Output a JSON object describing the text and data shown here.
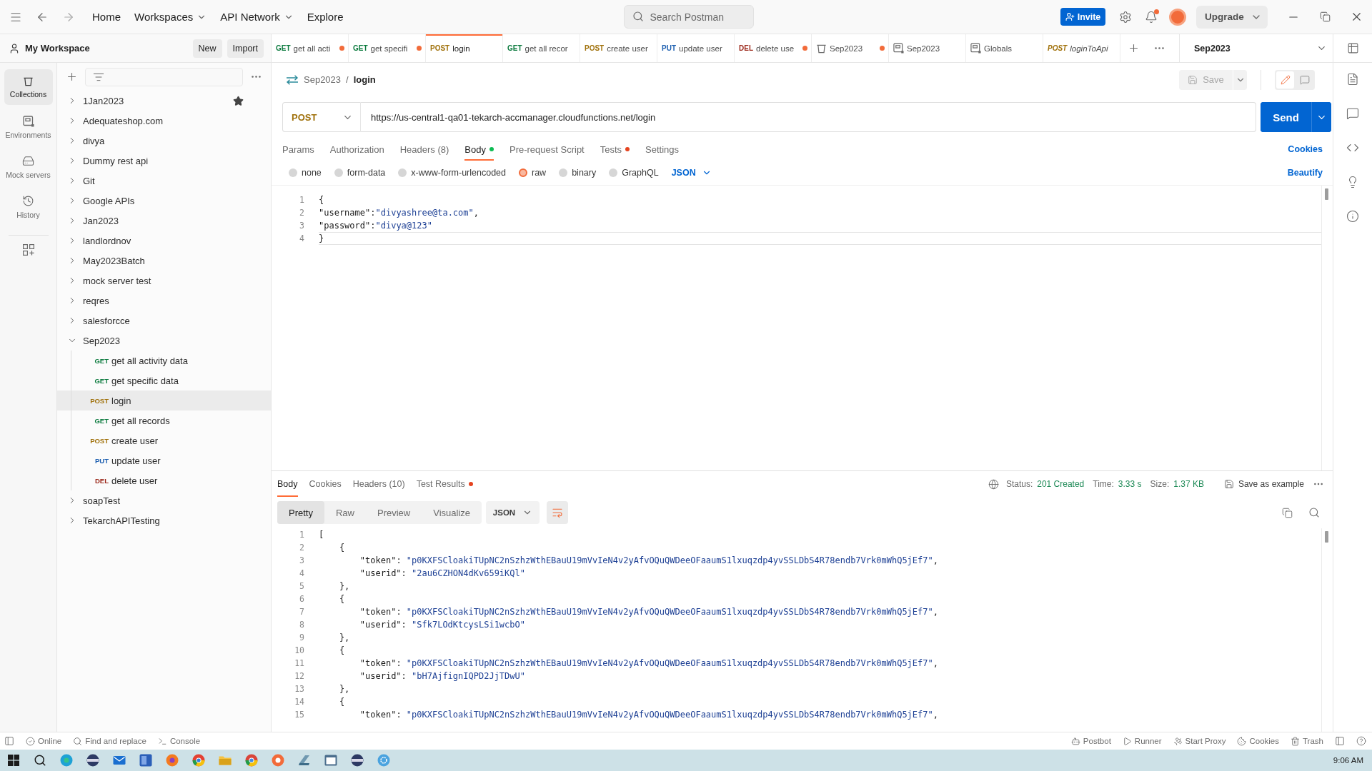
{
  "title_bar": {
    "nav": [
      {
        "label": "Home",
        "dropdown": false
      },
      {
        "label": "Workspaces",
        "dropdown": true
      },
      {
        "label": "API Network",
        "dropdown": true
      },
      {
        "label": "Explore",
        "dropdown": false
      }
    ],
    "search": {
      "placeholder": "Search Postman"
    },
    "invite": "Invite",
    "notifications_unread": true,
    "upgrade": "Upgrade"
  },
  "workspace": {
    "name": "My Workspace",
    "buttons": [
      "New",
      "Import"
    ]
  },
  "tabs": [
    {
      "kind": "request",
      "method": "GET",
      "color": "#0b7a3e",
      "title": "get all acti",
      "unsaved": true,
      "selected": false,
      "preview": false
    },
    {
      "kind": "request",
      "method": "GET",
      "color": "#0b7a3e",
      "title": "get specifi",
      "unsaved": true,
      "selected": false,
      "preview": false
    },
    {
      "kind": "request",
      "method": "POST",
      "color": "#a0710b",
      "title": "login",
      "unsaved": false,
      "selected": true,
      "preview": false
    },
    {
      "kind": "request",
      "method": "GET",
      "color": "#0b7a3e",
      "title": "get all recor",
      "unsaved": false,
      "selected": false,
      "preview": false
    },
    {
      "kind": "request",
      "method": "POST",
      "color": "#a0710b",
      "title": "create user",
      "unsaved": false,
      "selected": false,
      "preview": false
    },
    {
      "kind": "request",
      "method": "PUT",
      "color": "#1d5fb0",
      "title": "update user",
      "unsaved": false,
      "selected": false,
      "preview": false
    },
    {
      "kind": "request",
      "method": "DEL",
      "color": "#9c2a1c",
      "title": "delete use",
      "unsaved": true,
      "selected": false,
      "preview": false
    },
    {
      "kind": "collection",
      "title": "Sep2023",
      "unsaved": true,
      "selected": false,
      "preview": false
    },
    {
      "kind": "environment",
      "title": "Sep2023",
      "unsaved": false,
      "selected": false,
      "preview": false
    },
    {
      "kind": "environment",
      "title": "Globals",
      "unsaved": false,
      "selected": false,
      "preview": false
    },
    {
      "kind": "request",
      "method": "POST",
      "color": "#a0710b",
      "title": "loginToApi",
      "unsaved": false,
      "selected": false,
      "preview": true
    }
  ],
  "environment_selector": {
    "value": "Sep2023"
  },
  "rail": [
    {
      "kind": "collections",
      "label": "Collections",
      "selected": true
    },
    {
      "kind": "environments",
      "label": "Environments",
      "selected": false
    },
    {
      "kind": "mock",
      "label": "Mock servers",
      "selected": false
    },
    {
      "kind": "history",
      "label": "History",
      "selected": false
    }
  ],
  "sidebar": {
    "collections": [
      {
        "name": "1Jan2023",
        "expanded": false,
        "starred": true
      },
      {
        "name": "Adequateshop.com",
        "expanded": false,
        "starred": false
      },
      {
        "name": "divya",
        "expanded": false,
        "starred": false
      },
      {
        "name": "Dummy rest api",
        "expanded": false,
        "starred": false
      },
      {
        "name": "Git",
        "expanded": false,
        "starred": false
      },
      {
        "name": "Google APIs",
        "expanded": false,
        "starred": false
      },
      {
        "name": "Jan2023",
        "expanded": false,
        "starred": false
      },
      {
        "name": "landlordnov",
        "expanded": false,
        "starred": false
      },
      {
        "name": "May2023Batch",
        "expanded": false,
        "starred": false
      },
      {
        "name": "mock server test",
        "expanded": false,
        "starred": false
      },
      {
        "name": "reqres",
        "expanded": false,
        "starred": false
      },
      {
        "name": "salesforcce",
        "expanded": false,
        "starred": false
      },
      {
        "name": "Sep2023",
        "expanded": true,
        "starred": false,
        "children": [
          {
            "method": "GET",
            "color": "#0b7a3e",
            "name": "get all activity data",
            "selected": false
          },
          {
            "method": "GET",
            "color": "#0b7a3e",
            "name": "get specific data",
            "selected": false
          },
          {
            "method": "POST",
            "color": "#a0710b",
            "name": "login",
            "selected": true
          },
          {
            "method": "GET",
            "color": "#0b7a3e",
            "name": "get all records",
            "selected": false
          },
          {
            "method": "POST",
            "color": "#a0710b",
            "name": "create user",
            "selected": false
          },
          {
            "method": "PUT",
            "color": "#1d5fb0",
            "name": "update user",
            "selected": false
          },
          {
            "method": "DEL",
            "color": "#9c2a1c",
            "name": "delete user",
            "selected": false
          }
        ]
      },
      {
        "name": "soapTest",
        "expanded": false,
        "starred": false
      },
      {
        "name": "TekarchAPITesting",
        "expanded": false,
        "starred": false
      }
    ]
  },
  "request": {
    "breadcrumb": {
      "parent": "Sep2023",
      "separator": "/",
      "current": "login"
    },
    "save": {
      "label": "Save",
      "disabled": true
    },
    "view_toggle": [
      {
        "kind": "edit",
        "selected": true
      },
      {
        "kind": "comments",
        "selected": false
      }
    ],
    "method": "POST",
    "url": "https://us-central1-qa01-tekarch-accmanager.cloudfunctions.net/login",
    "send": "Send",
    "tabs": [
      {
        "label": "Params",
        "selected": false
      },
      {
        "label": "Authorization",
        "selected": false
      },
      {
        "label": "Headers (8)",
        "selected": false
      },
      {
        "label": "Body",
        "selected": true,
        "dot": {
          "color": "#0cbb52"
        }
      },
      {
        "label": "Pre-request Script",
        "selected": false
      },
      {
        "label": "Tests",
        "selected": false,
        "dot": {
          "color": "#e5431f"
        }
      },
      {
        "label": "Settings",
        "selected": false
      }
    ],
    "cookies": "Cookies",
    "body_modes": [
      {
        "label": "none",
        "selected": false
      },
      {
        "label": "form-data",
        "selected": false
      },
      {
        "label": "x-www-form-urlencoded",
        "selected": false
      },
      {
        "label": "raw",
        "selected": true
      },
      {
        "label": "binary",
        "selected": false
      },
      {
        "label": "GraphQL",
        "selected": false
      }
    ],
    "body_format": "JSON",
    "beautify": "Beautify",
    "body_lines": [
      {
        "n": "1",
        "code": "{",
        "active": false
      },
      {
        "n": "2",
        "code": "\"username\":\"divyashree@ta.com\",",
        "active": false
      },
      {
        "n": "3",
        "code": "\"password\":\"divya@123\"",
        "active": false
      },
      {
        "n": "4",
        "code": "}",
        "active": true
      }
    ]
  },
  "response": {
    "tabs": [
      {
        "label": "Body",
        "selected": true
      },
      {
        "label": "Cookies",
        "selected": false
      },
      {
        "label": "Headers (10)",
        "selected": false
      },
      {
        "label": "Test Results",
        "selected": false,
        "dot": {
          "color": "#e5431f"
        }
      }
    ],
    "status": {
      "label": "Status:",
      "value": "201 Created"
    },
    "time": {
      "label": "Time:",
      "value": "3.33 s"
    },
    "size": {
      "label": "Size:",
      "value": "1.37 KB"
    },
    "save_example": "Save as example",
    "views": [
      {
        "label": "Pretty",
        "selected": true
      },
      {
        "label": "Raw",
        "selected": false
      },
      {
        "label": "Preview",
        "selected": false
      },
      {
        "label": "Visualize",
        "selected": false
      }
    ],
    "format": "JSON",
    "wrap": {
      "on": true
    },
    "lines": [
      {
        "n": "1",
        "code": "["
      },
      {
        "n": "2",
        "code": "    {"
      },
      {
        "n": "3",
        "code": "        \"token\": \"p0KXFSCloakiTUpNC2nSzhzWthEBauU19mVvIeN4v2yAfvOQuQWDeeOFaaumS1lxuqzdp4yvSSLDbS4R78endb7Vrk0mWhQ5jEf7\","
      },
      {
        "n": "4",
        "code": "        \"userid\": \"2au6CZHON4dKv659iKQl\""
      },
      {
        "n": "5",
        "code": "    },"
      },
      {
        "n": "6",
        "code": "    {"
      },
      {
        "n": "7",
        "code": "        \"token\": \"p0KXFSCloakiTUpNC2nSzhzWthEBauU19mVvIeN4v2yAfvOQuQWDeeOFaaumS1lxuqzdp4yvSSLDbS4R78endb7Vrk0mWhQ5jEf7\","
      },
      {
        "n": "8",
        "code": "        \"userid\": \"Sfk7LOdKtcysLSi1wcbO\""
      },
      {
        "n": "9",
        "code": "    },"
      },
      {
        "n": "10",
        "code": "    {"
      },
      {
        "n": "11",
        "code": "        \"token\": \"p0KXFSCloakiTUpNC2nSzhzWthEBauU19mVvIeN4v2yAfvOQuQWDeeOFaaumS1lxuqzdp4yvSSLDbS4R78endb7Vrk0mWhQ5jEf7\","
      },
      {
        "n": "12",
        "code": "        \"userid\": \"bH7AjfignIQPD2JjTDwU\""
      },
      {
        "n": "13",
        "code": "    },"
      },
      {
        "n": "14",
        "code": "    {"
      },
      {
        "n": "15",
        "code": "        \"token\": \"p0KXFSCloakiTUpNC2nSzhzWthEBauU19mVvIeN4v2yAfvOQuQWDeeOFaaumS1lxuqzdp4yvSSLDbS4R78endb7Vrk0mWhQ5jEf7\","
      }
    ]
  },
  "status_bar": {
    "left": [
      {
        "kind": "online",
        "label": "Online"
      },
      {
        "kind": "find",
        "label": "Find and replace"
      },
      {
        "kind": "console",
        "label": "Console"
      }
    ],
    "right": [
      {
        "kind": "postbot",
        "label": "Postbot"
      },
      {
        "kind": "runner",
        "label": "Runner"
      },
      {
        "kind": "proxy",
        "label": "Start Proxy"
      },
      {
        "kind": "cookies",
        "label": "Cookies"
      },
      {
        "kind": "trash",
        "label": "Trash"
      }
    ]
  },
  "taskbar": {
    "time": "9:06 AM"
  }
}
